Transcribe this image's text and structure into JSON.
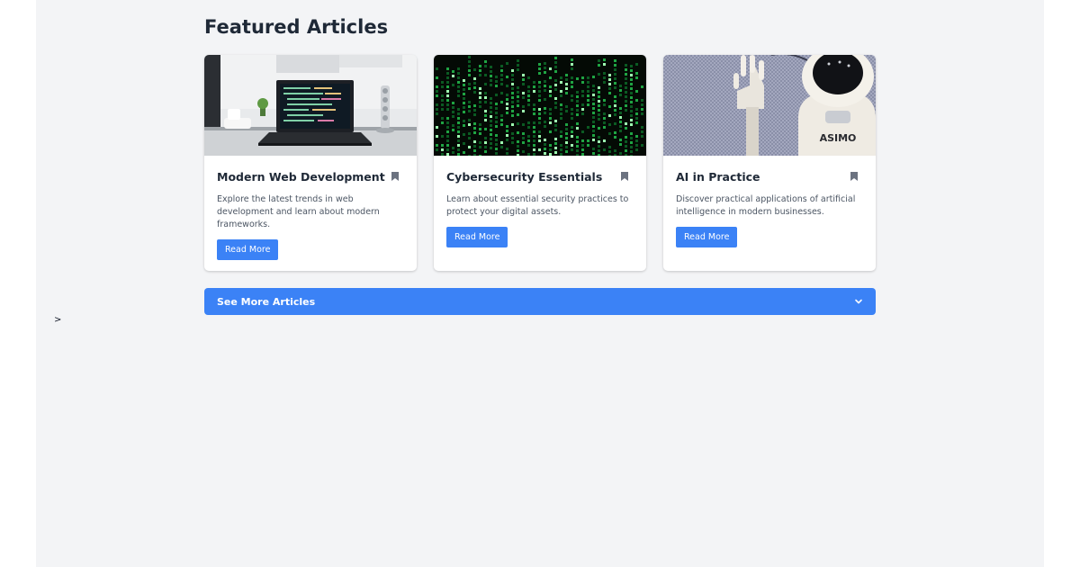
{
  "section": {
    "title": "Featured Articles"
  },
  "articles": [
    {
      "title": "Modern Web Development",
      "description": "Explore the latest trends in web development and learn about modern frameworks.",
      "button_label": "Read More",
      "image_icon": "laptop-code-image",
      "bookmark_icon": "bookmark-icon"
    },
    {
      "title": "Cybersecurity Essentials",
      "description": "Learn about essential security practices to protect your digital assets.",
      "button_label": "Read More",
      "image_icon": "matrix-code-image",
      "bookmark_icon": "bookmark-icon"
    },
    {
      "title": "AI in Practice",
      "description": "Discover practical applications of artificial intelligence in modern businesses.",
      "button_label": "Read More",
      "image_icon": "robot-image",
      "bookmark_icon": "bookmark-icon",
      "robot_label": "ASIMO"
    }
  ],
  "see_more": {
    "label": "See More Articles",
    "icon": "chevron-down-icon"
  },
  "stray_text": ">",
  "colors": {
    "accent": "#3b82f6",
    "page_bg": "#f3f4f6",
    "title": "#1f2937",
    "body_text": "#4b5563",
    "bookmark": "#6b7280"
  }
}
